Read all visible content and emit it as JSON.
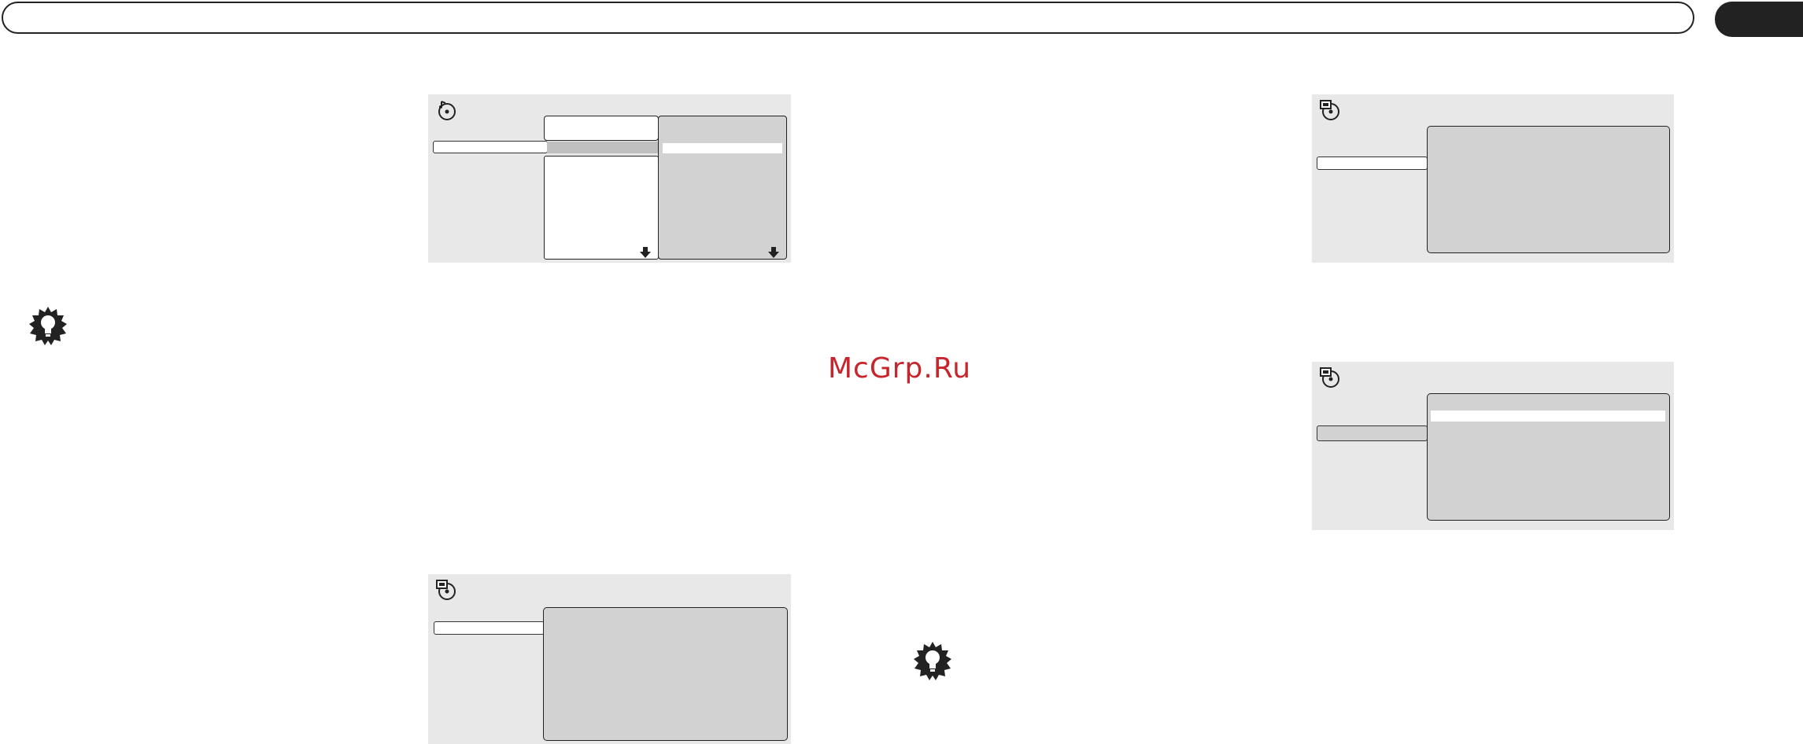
{
  "watermark": {
    "text": "McGrp.Ru"
  },
  "icons": {
    "tip": "lightbulb-tip-icon",
    "audio_disc": "audio-disc-icon",
    "video_disc": "video-disc-icon",
    "scroll_down": "scroll-down-arrow-icon"
  },
  "colors": {
    "panel_bg": "#e8e8e8",
    "menu_grey": "#d2d2d2",
    "watermark": "#c8242c",
    "header_tab": "#222222"
  }
}
